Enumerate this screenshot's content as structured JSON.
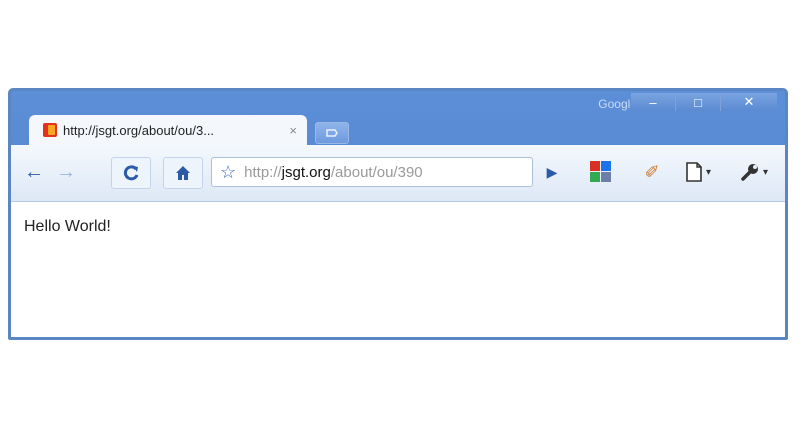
{
  "window": {
    "brand": "Google",
    "controls": {
      "minimize": "–",
      "maximize": "□",
      "close": "✕"
    }
  },
  "tab": {
    "title": "http://jsgt.org/about/ou/3...",
    "close": "×"
  },
  "toolbar": {
    "back_icon": "←",
    "forward_icon": "→",
    "reload_icon": "C",
    "home_icon": "⌂",
    "star_icon": "☆",
    "go_icon": "▶",
    "page_icon": "🗋",
    "wrench_icon": "🔧",
    "caret": "▾",
    "ext2_icon": "✐"
  },
  "omnibox": {
    "prefix": "http://",
    "host": "jsgt.org",
    "path": "/about/ou/390"
  },
  "page": {
    "text": "Hello World!"
  },
  "colors": {
    "frame": "#4a7cc8",
    "toolbar": "#e6eef9",
    "accent": "#2b5aa8"
  }
}
